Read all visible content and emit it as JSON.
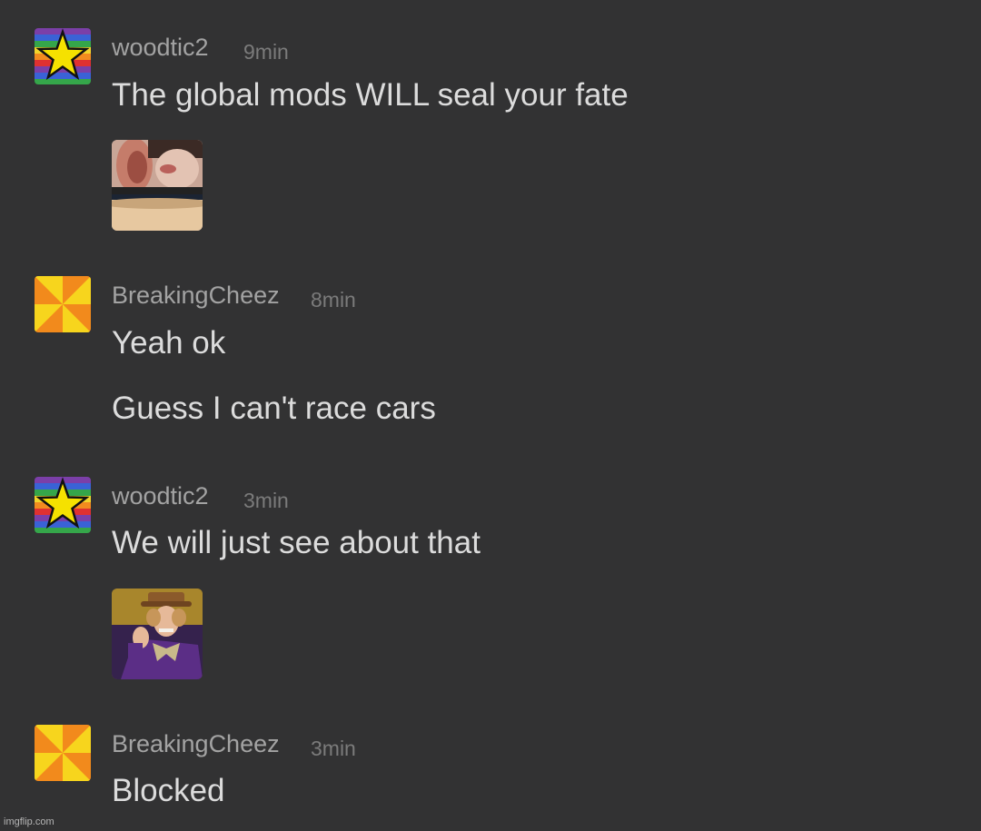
{
  "messages": [
    {
      "username": "woodtic2",
      "time": "9min",
      "avatar": "rainbow-star-avatar",
      "lines": [
        "The global mods WILL seal your fate"
      ],
      "image": "whisper-meme-thumbnail"
    },
    {
      "username": "BreakingCheez",
      "time": "8min",
      "avatar": "orange-yellow-pinwheel-avatar",
      "lines": [
        "Yeah ok",
        "Guess I can't race cars"
      ]
    },
    {
      "username": "woodtic2",
      "time": "3min",
      "avatar": "rainbow-star-avatar",
      "lines": [
        "We will just see about that"
      ],
      "image": "wonka-meme-thumbnail"
    },
    {
      "username": "BreakingCheez",
      "time": "3min",
      "avatar": "orange-yellow-pinwheel-avatar",
      "lines": [
        "Blocked"
      ]
    }
  ],
  "watermark": "imgflip.com",
  "colors": {
    "background": "#323233",
    "username": "#a3a3a3",
    "time": "#7b7b7b",
    "text": "#dcdcdc"
  }
}
